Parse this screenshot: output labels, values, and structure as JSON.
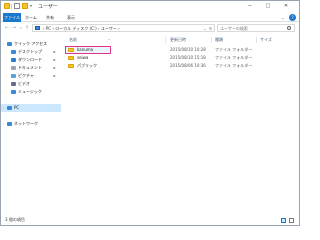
{
  "window": {
    "title": "ユーザー",
    "minimize_glyph": "─",
    "maximize_glyph": "□",
    "close_glyph": "✕",
    "quick_access_dropdown_glyph": "▾"
  },
  "ribbon": {
    "tabs": [
      "ファイル",
      "ホーム",
      "共有",
      "表示"
    ],
    "expand_glyph": "⌄",
    "help_glyph": "?"
  },
  "nav": {
    "back_glyph": "←",
    "forward_glyph": "→",
    "recent_glyph": "▾",
    "up_glyph": "↑",
    "address_path": "›  PC  ›  ローカル ディスク (C:)  ›  ユーザー  ›",
    "address_dropdown_glyph": "⌄",
    "refresh_glyph": "↻",
    "search_placeholder": "ユーザーの検索"
  },
  "tree": {
    "quick_access": "クイック アクセス",
    "desktop": "デスクトップ",
    "downloads": "ダウンロード",
    "documents": "ドキュメント",
    "pictures": "ピクチャ",
    "videos": "ビデオ",
    "music": "ミュージック",
    "pc": "PC",
    "network": "ネットワーク",
    "pin_glyph": "✱",
    "expand_glyph": "›"
  },
  "columns": {
    "name": "名前",
    "date": "更新日時",
    "type": "種類",
    "size": "サイズ",
    "sort_glyph": "^"
  },
  "files": [
    {
      "name": "kanuma",
      "date": "",
      "type": "ファイル フォルダー"
    },
    {
      "name": "seiwa",
      "date": "2015/08/10 15:18",
      "type": "ファイル フォルダー"
    },
    {
      "name": "パブリック",
      "date": "2015/08/06 10:36",
      "type": "ファイル フォルダー"
    }
  ],
  "first_row_date": "2015/08/10 10:28",
  "status": {
    "item_count": "3 個の項目"
  },
  "colors": {
    "accent": "#1979ca",
    "highlight_border": "#e0358a",
    "folder": "#f4c430",
    "selection": "#cce8ff"
  }
}
